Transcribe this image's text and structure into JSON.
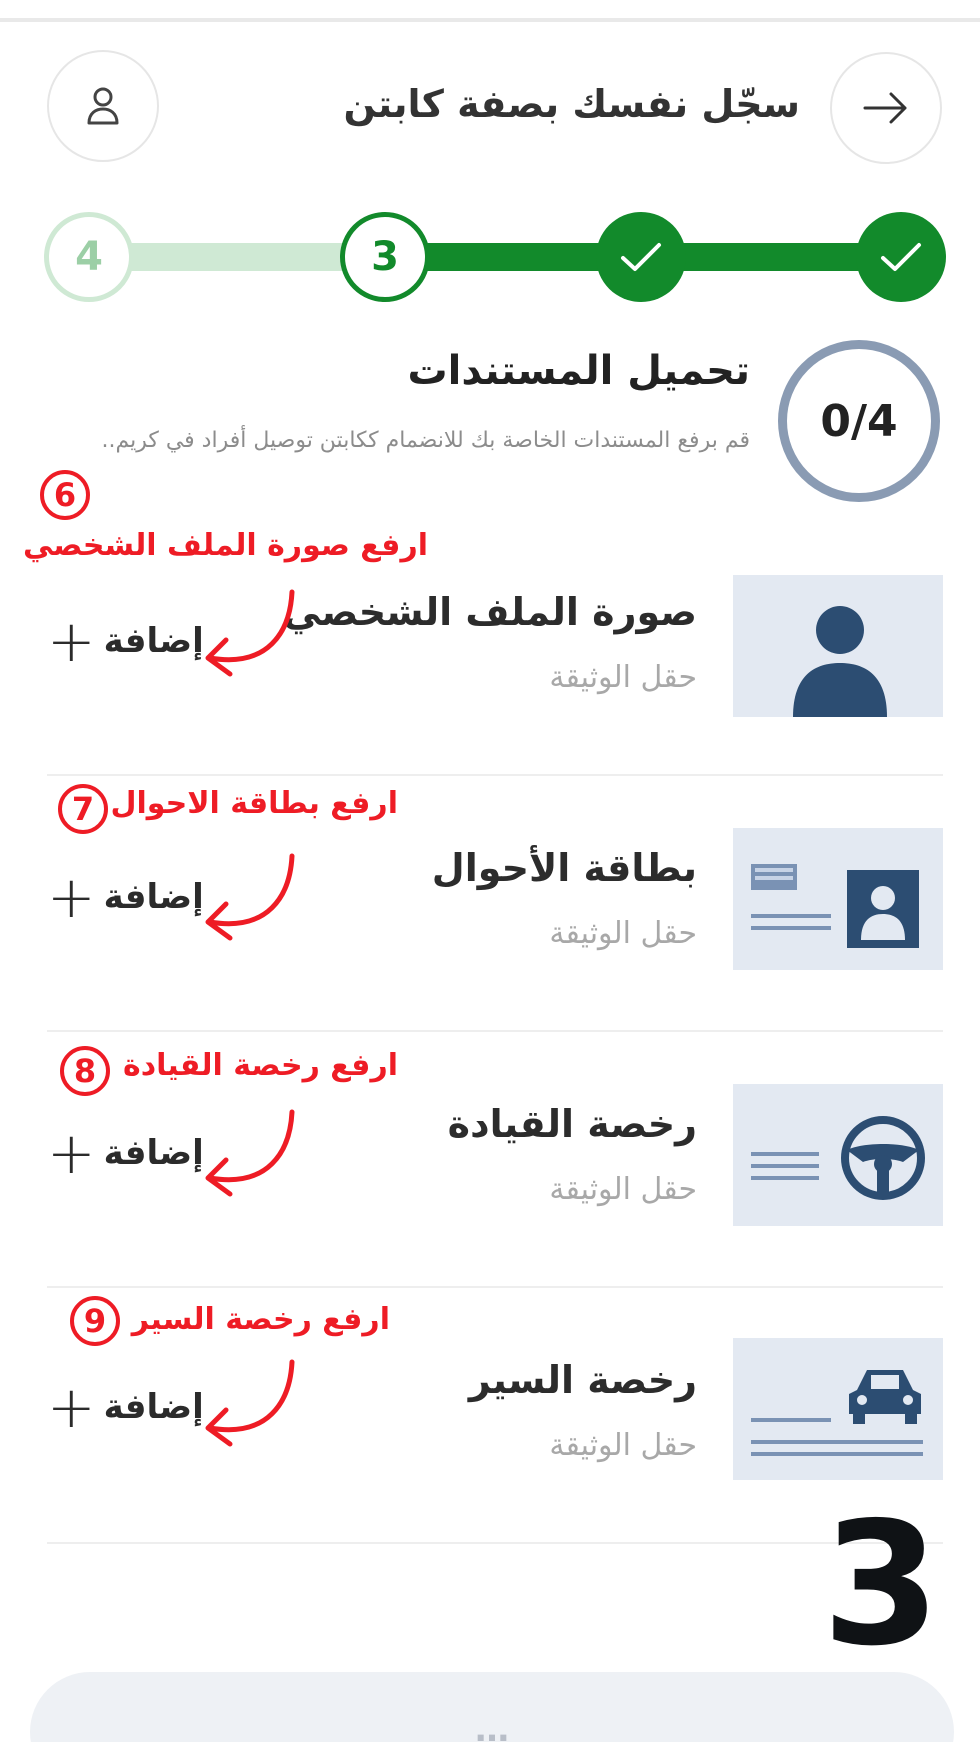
{
  "header": {
    "title": "سجّل نفسك بصفة كابتن",
    "back_icon": "arrow-right-icon",
    "user_icon": "user-icon"
  },
  "stepper": {
    "steps": [
      "✓",
      "✓",
      "3",
      "4"
    ],
    "current": 3
  },
  "progress": {
    "text": "0/4"
  },
  "section": {
    "title": "تحميل المستندات",
    "description": "قم برفع المستندات الخاصة بك للانضمام ككابتن توصيل أفراد في كريم.."
  },
  "documents": [
    {
      "name": "صورة الملف الشخصي",
      "subtitle": "حقل الوثيقة",
      "add_label": "إضافة",
      "icon": "profile-photo-icon",
      "annotation": "ارفع صورة الملف الشخصي",
      "annotation_number": "6"
    },
    {
      "name": "بطاقة الأحوال",
      "subtitle": "حقل الوثيقة",
      "add_label": "إضافة",
      "icon": "id-card-icon",
      "annotation": "ارفع بطاقة الاحوال",
      "annotation_number": "7"
    },
    {
      "name": "رخصة القيادة",
      "subtitle": "حقل الوثيقة",
      "add_label": "إضافة",
      "icon": "steering-wheel-icon",
      "annotation": "ارفع رخصة القيادة",
      "annotation_number": "8"
    },
    {
      "name": "رخصة السير",
      "subtitle": "حقل الوثيقة",
      "add_label": "إضافة",
      "icon": "car-icon",
      "annotation": "ارفع رخصة السير",
      "annotation_number": "9"
    }
  ],
  "page_number": "3",
  "colors": {
    "accent_green": "#128a2b",
    "light_green": "#cfe9d4",
    "annotation_red": "#ee1c25",
    "thumb_bg": "#e3e9f2",
    "icon_blue": "#2c4d72"
  }
}
